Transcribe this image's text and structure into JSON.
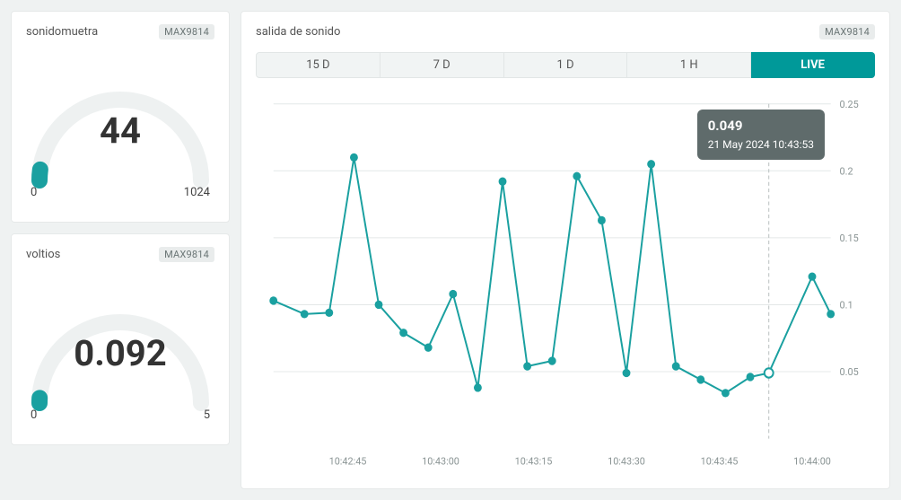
{
  "left": {
    "gauges": [
      {
        "title": "sonidomuetra",
        "badge": "MAX9814",
        "value": "44",
        "min": "0",
        "max": "1024",
        "fraction": 0.043
      },
      {
        "title": "voltios",
        "badge": "MAX9814",
        "value": "0.092",
        "min": "0",
        "max": "5",
        "fraction": 0.018
      }
    ]
  },
  "chart": {
    "title": "salida de sonido",
    "badge": "MAX9814",
    "ranges": [
      "15 D",
      "7 D",
      "1 D",
      "1 H",
      "LIVE"
    ],
    "active_range_index": 4,
    "tooltip": {
      "value": "0.049",
      "time": "21 May 2024 10:43:53"
    }
  },
  "chart_data": {
    "type": "line",
    "title": "salida de sonido",
    "xlabel": "",
    "ylabel": "",
    "ylim": [
      0,
      0.25
    ],
    "yticks": [
      0.05,
      0.1,
      0.15,
      0.2,
      0.25
    ],
    "xticks": [
      "10:42:45",
      "10:43:00",
      "10:43:15",
      "10:43:30",
      "10:43:45",
      "10:44:00"
    ],
    "x": [
      "10:42:33",
      "10:42:38",
      "10:42:42",
      "10:42:46",
      "10:42:50",
      "10:42:54",
      "10:42:58",
      "10:43:02",
      "10:43:06",
      "10:43:10",
      "10:43:14",
      "10:43:18",
      "10:43:22",
      "10:43:26",
      "10:43:30",
      "10:43:34",
      "10:43:38",
      "10:43:42",
      "10:43:46",
      "10:43:50",
      "10:43:53",
      "10:44:00",
      "10:44:03"
    ],
    "values": [
      0.103,
      0.093,
      0.094,
      0.21,
      0.1,
      0.079,
      0.068,
      0.108,
      0.038,
      0.192,
      0.054,
      0.058,
      0.196,
      0.163,
      0.049,
      0.205,
      0.054,
      0.044,
      0.034,
      0.046,
      0.049,
      0.121,
      0.093
    ],
    "cursor_index": 20
  }
}
